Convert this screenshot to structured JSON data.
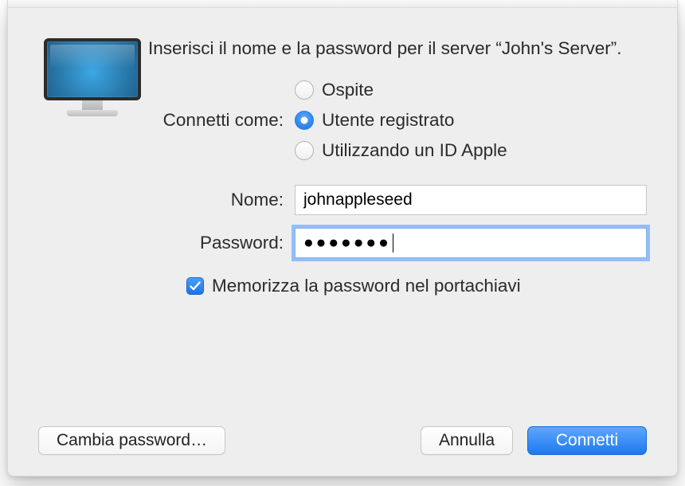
{
  "headline": "Inserisci il nome e la password per il server “John's Server”.",
  "connect_as_label": "Connetti come:",
  "radios": {
    "guest": "Ospite",
    "registered": "Utente registrato",
    "apple_id": "Utilizzando un ID Apple",
    "selected": "registered"
  },
  "fields": {
    "name_label": "Nome:",
    "name_value": "johnappleseed",
    "password_label": "Password:",
    "password_mask": "●●●●●●●"
  },
  "remember": {
    "label": "Memorizza la password nel portachiavi",
    "checked": true
  },
  "buttons": {
    "change_pw": "Cambia password…",
    "cancel": "Annulla",
    "connect": "Connetti"
  }
}
